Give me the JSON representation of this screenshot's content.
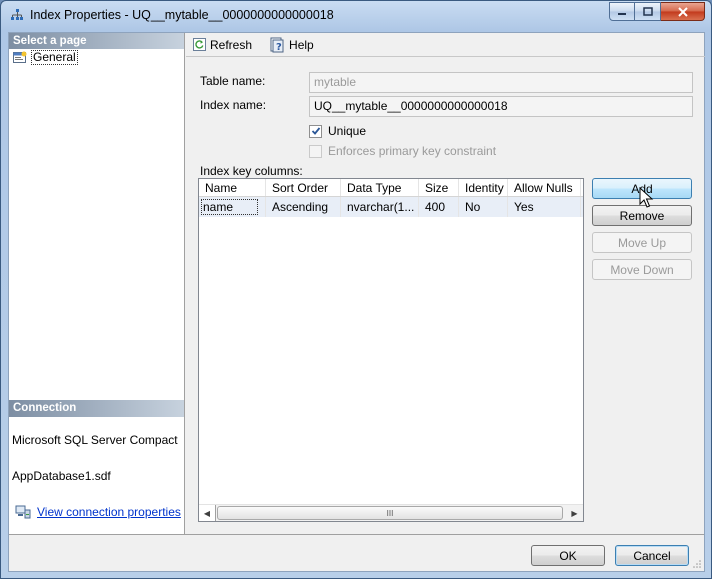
{
  "window": {
    "title": "Index Properties - UQ__mytable__0000000000000018",
    "icon": "index-icon"
  },
  "left_panel": {
    "select_page_header": "Select a page",
    "pages": [
      {
        "label": "General",
        "icon": "general-page-icon",
        "selected": true
      }
    ],
    "connection_header": "Connection",
    "server": "Microsoft SQL Server Compact",
    "database": "AppDatabase1.sdf",
    "view_connection_link": "View connection properties"
  },
  "toolbar": {
    "refresh_label": "Refresh",
    "help_label": "Help"
  },
  "form": {
    "table_name_label": "Table name:",
    "table_name_value": "mytable",
    "index_name_label": "Index name:",
    "index_name_value": "UQ__mytable__0000000000000018",
    "unique_label": "Unique",
    "unique_checked": true,
    "enforces_pk_label": "Enforces primary key constraint",
    "enforces_pk_checked": false,
    "key_columns_label": "Index key columns:"
  },
  "grid": {
    "columns": [
      "Name",
      "Sort Order",
      "Data Type",
      "Size",
      "Identity",
      "Allow Nulls"
    ],
    "rows": [
      [
        "name",
        "Ascending",
        "nvarchar(1...",
        "400",
        "No",
        "Yes"
      ]
    ],
    "scroll_thumb_glyph": "III"
  },
  "side_buttons": {
    "add": "Add",
    "remove": "Remove",
    "move_up": "Move Up",
    "move_down": "Move Down"
  },
  "footer": {
    "ok": "OK",
    "cancel": "Cancel"
  }
}
